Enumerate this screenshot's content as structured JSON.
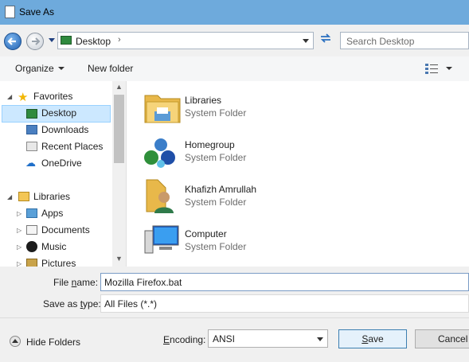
{
  "window": {
    "title": "Save As"
  },
  "address": {
    "location": "Desktop",
    "search_placeholder": "Search Desktop"
  },
  "toolbar": {
    "organize_label": "Organize",
    "new_folder_label": "New folder"
  },
  "nav": {
    "favorites_label": "Favorites",
    "favorites_items": [
      "Desktop",
      "Downloads",
      "Recent Places",
      "OneDrive"
    ],
    "libraries_label": "Libraries",
    "libraries_items": [
      "Apps",
      "Documents",
      "Music",
      "Pictures"
    ]
  },
  "items": [
    {
      "title": "Libraries",
      "subtitle": "System Folder",
      "icon": "libraries-folder-icon"
    },
    {
      "title": "Homegroup",
      "subtitle": "System Folder",
      "icon": "homegroup-icon"
    },
    {
      "title": "Khafizh Amrullah",
      "subtitle": "System Folder",
      "icon": "user-folder-icon"
    },
    {
      "title": "Computer",
      "subtitle": "System Folder",
      "icon": "computer-icon"
    }
  ],
  "form": {
    "file_name_label_pre": "File ",
    "file_name_label_ul": "n",
    "file_name_label_post": "ame:",
    "file_name_value": "Mozilla Firefox.bat",
    "save_type_label_pre": "Save as ",
    "save_type_label_ul": "t",
    "save_type_label_post": "ype:",
    "save_type_value": "All Files  (*.*)",
    "encoding_label_ul": "E",
    "encoding_label_post": "ncoding:",
    "encoding_value": "ANSI"
  },
  "buttons": {
    "hide_folders": "Hide Folders",
    "save_ul": "S",
    "save_post": "ave",
    "cancel": "Cancel"
  }
}
